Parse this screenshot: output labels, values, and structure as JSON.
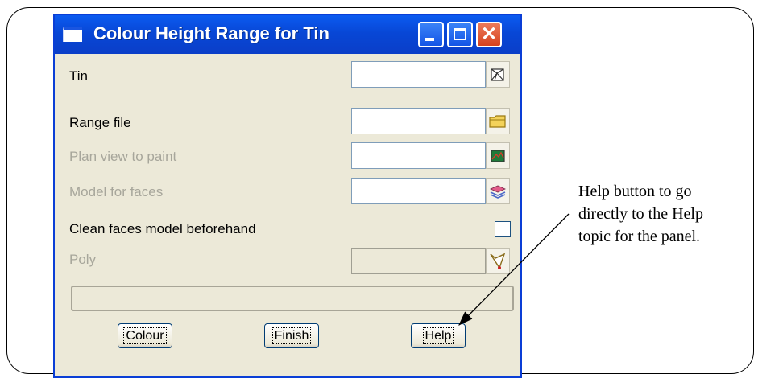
{
  "window": {
    "title": "Colour Height Range for Tin",
    "controls": {
      "minimize": "minimize",
      "maximize": "maximize",
      "close": "✕"
    }
  },
  "fields": [
    {
      "label": "Tin",
      "enabled": true,
      "value": "",
      "icon": "tin-icon"
    },
    {
      "label": "Range file",
      "enabled": true,
      "value": "",
      "icon": "folder-icon"
    },
    {
      "label": "Plan view to paint",
      "enabled": false,
      "value": "",
      "icon": "plan-view-icon"
    },
    {
      "label": "Model for faces",
      "enabled": false,
      "value": "",
      "icon": "layers-icon"
    }
  ],
  "checkbox": {
    "label": "Clean faces model beforehand",
    "checked": false
  },
  "poly": {
    "label": "Poly",
    "enabled": false,
    "value": "",
    "icon": "polygon-icon"
  },
  "status_text": "",
  "buttons": {
    "colour": "Colour",
    "finish": "Finish",
    "help": "Help"
  },
  "annotation": {
    "line1": "Help button to go",
    "line2": "directly to the Help",
    "line3": "topic for the panel."
  }
}
